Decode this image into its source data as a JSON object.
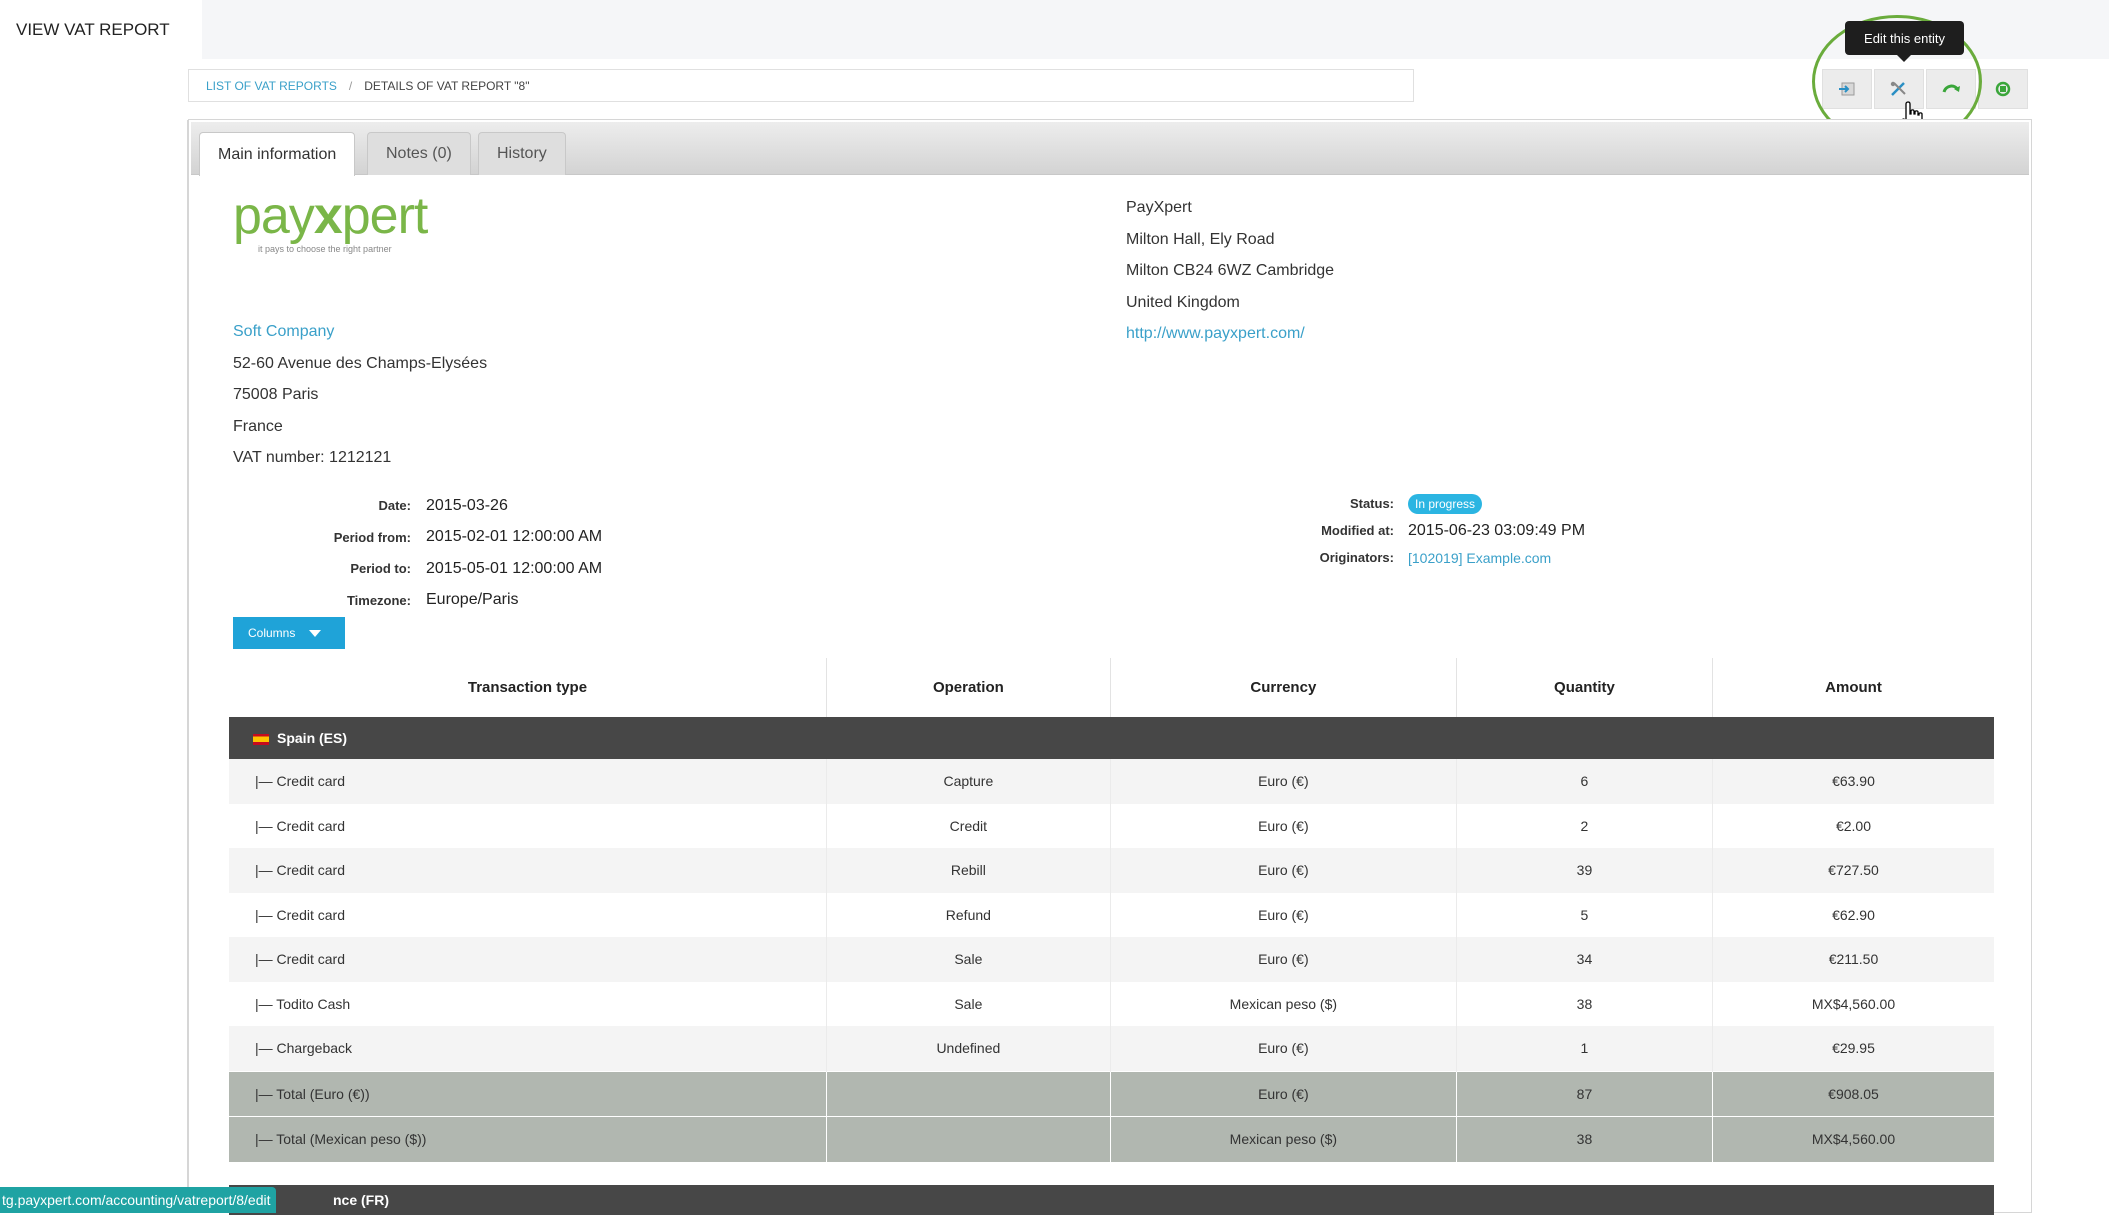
{
  "page": {
    "title": "VIEW VAT REPORT"
  },
  "breadcrumb": {
    "parent": "LIST OF VAT REPORTS",
    "separator": "/",
    "current": "DETAILS OF VAT REPORT \"8\""
  },
  "toolbar": {
    "tooltip": "Edit this entity",
    "buttons": [
      "export-icon",
      "edit-icon",
      "undo-icon",
      "refresh-icon"
    ]
  },
  "tabs": [
    {
      "label": "Main information"
    },
    {
      "label": "Notes (0)"
    },
    {
      "label": "History"
    }
  ],
  "logo": {
    "text_left": "pay",
    "text_x": "x",
    "text_right": "pert",
    "tagline": "it pays to choose the right partner"
  },
  "client": {
    "name": "Soft Company",
    "address1": "52-60 Avenue des Champs-Elysées",
    "address2": "75008 Paris",
    "country": "France",
    "vat": "VAT number: 1212121"
  },
  "company": {
    "name": "PayXpert",
    "address1": "Milton Hall, Ely Road",
    "address2": "Milton CB24 6WZ Cambridge",
    "country": "United Kingdom",
    "url": "http://www.payxpert.com/"
  },
  "meta_left": [
    {
      "label": "Date:",
      "value": "2015-03-26"
    },
    {
      "label": "Period from:",
      "value": "2015-02-01 12:00:00 AM"
    },
    {
      "label": "Period to:",
      "value": "2015-05-01 12:00:00 AM"
    },
    {
      "label": "Timezone:",
      "value": "Europe/Paris"
    }
  ],
  "meta_right": {
    "status_label": "Status:",
    "status_value": "In progress",
    "modified_label": "Modified at:",
    "modified_value": "2015-06-23 03:09:49 PM",
    "originators_label": "Originators:",
    "originators_value": "[102019] Example.com"
  },
  "columns_button": "Columns",
  "table": {
    "headers": [
      "Transaction type",
      "Operation",
      "Currency",
      "Quantity",
      "Amount"
    ],
    "group": "Spain (ES)",
    "rows": [
      [
        "|— Credit card",
        "Capture",
        "Euro (€)",
        "6",
        "€63.90"
      ],
      [
        "|— Credit card",
        "Credit",
        "Euro (€)",
        "2",
        "€2.00"
      ],
      [
        "|— Credit card",
        "Rebill",
        "Euro (€)",
        "39",
        "€727.50"
      ],
      [
        "|— Credit card",
        "Refund",
        "Euro (€)",
        "5",
        "€62.90"
      ],
      [
        "|— Credit card",
        "Sale",
        "Euro (€)",
        "34",
        "€211.50"
      ],
      [
        "|— Todito Cash",
        "Sale",
        "Mexican peso ($)",
        "38",
        "MX$4,560.00"
      ],
      [
        "|— Chargeback",
        "Undefined",
        "Euro (€)",
        "1",
        "€29.95"
      ]
    ],
    "totals": [
      [
        "|— Total (Euro (€))",
        "",
        "Euro (€)",
        "87",
        "€908.05"
      ],
      [
        "|— Total (Mexican peso ($))",
        "",
        "Mexican peso ($)",
        "38",
        "MX$4,560.00"
      ]
    ],
    "next_group": "nce (FR)"
  },
  "statusbar": {
    "url": "tg.payxpert.com/accounting/vatreport/8/edit"
  }
}
